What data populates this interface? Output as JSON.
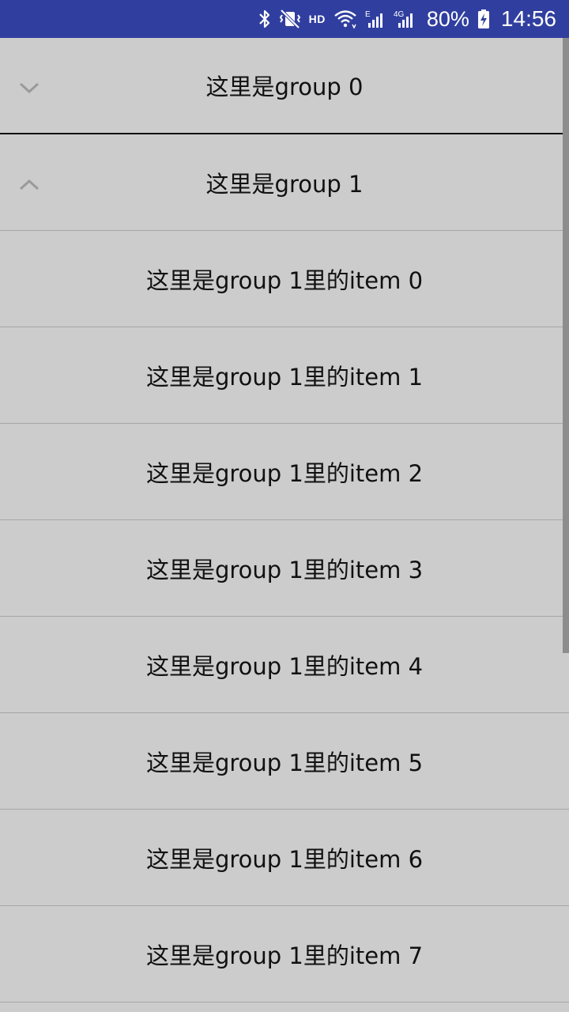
{
  "status_bar": {
    "icons": [
      "bluetooth-icon",
      "vibrate-mute-icon",
      "hd-badge",
      "wifi-icon",
      "signal-e-icon",
      "signal-4g-icon"
    ],
    "hd_label": "HD",
    "battery_text": "80%",
    "time": "14:56"
  },
  "list": {
    "groups": [
      {
        "label": "这里是group 0",
        "expanded": false,
        "icon": "chevron-down-icon"
      },
      {
        "label": "这里是group 1",
        "expanded": true,
        "icon": "chevron-up-icon"
      }
    ],
    "items": [
      "这里是group 1里的item 0",
      "这里是group 1里的item 1",
      "这里是group 1里的item 2",
      "这里是group 1里的item 3",
      "这里是group 1里的item 4",
      "这里是group 1里的item 5",
      "这里是group 1里的item 6",
      "这里是group 1里的item 7"
    ]
  },
  "colors": {
    "status_bar": "#303f9f",
    "background": "#cccccc",
    "divider": "#a6a6a6",
    "chevron": "#9a9a9a",
    "scrollbar": "#8d8d8d"
  }
}
